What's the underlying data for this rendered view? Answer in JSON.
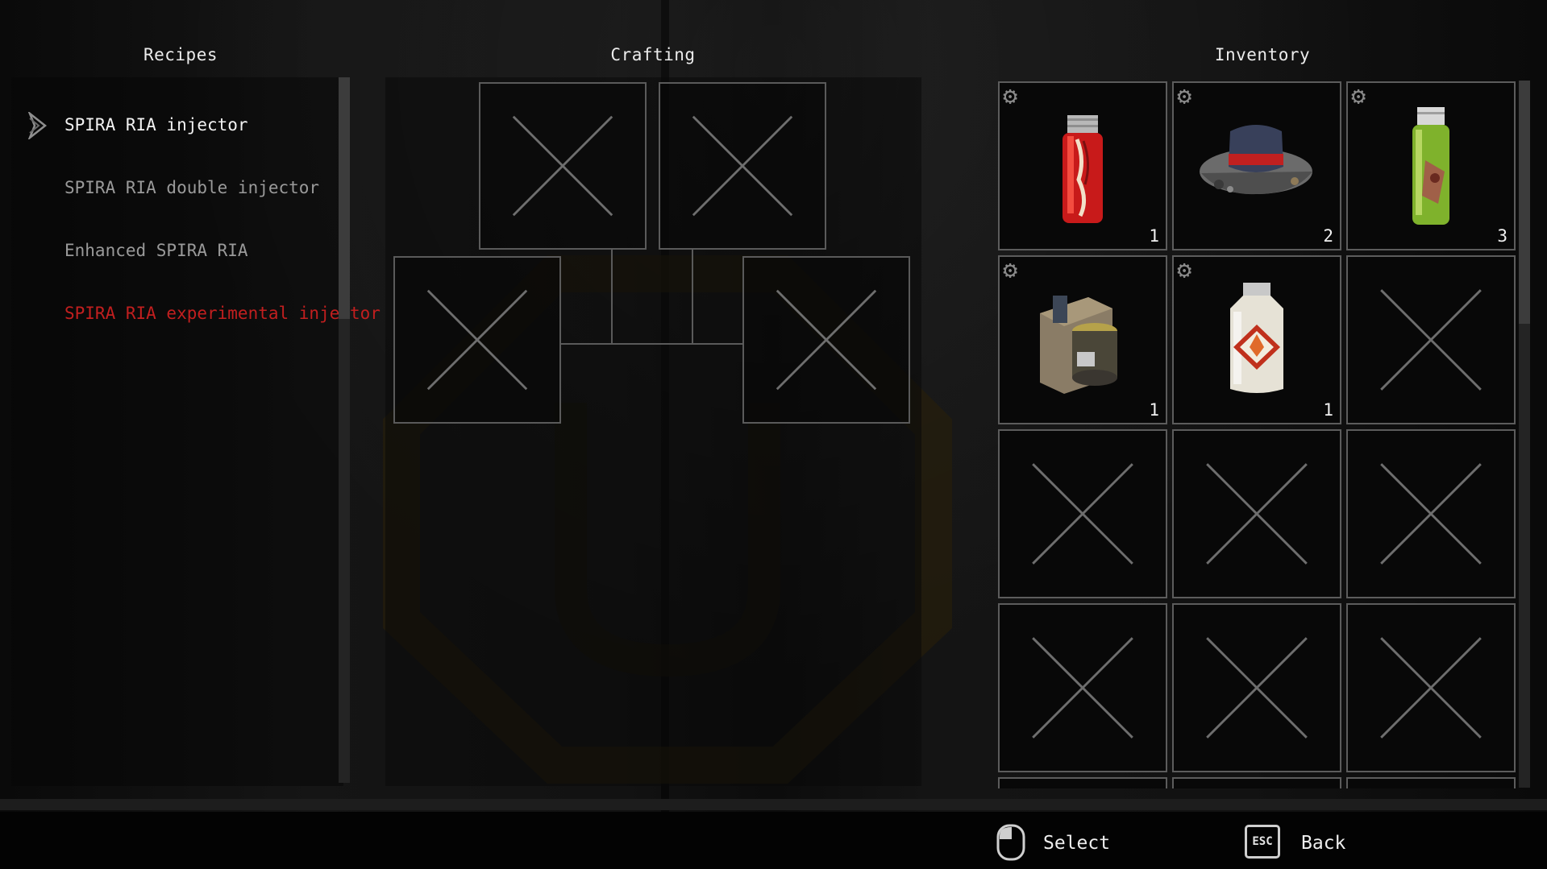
{
  "headings": {
    "recipes": "Recipes",
    "crafting": "Crafting",
    "inventory": "Inventory"
  },
  "recipes": [
    {
      "label": "SPIRA RIA injector",
      "state": "selected"
    },
    {
      "label": "SPIRA RIA double injector",
      "state": "available"
    },
    {
      "label": "Enhanced SPIRA RIA",
      "state": "available"
    },
    {
      "label": "SPIRA RIA experimental injector",
      "state": "unavailable"
    }
  ],
  "crafting_slots": [
    "empty",
    "empty",
    "empty",
    "empty"
  ],
  "inventory": [
    {
      "item": "red-vial-icon",
      "qty": "1"
    },
    {
      "item": "stone-hat-icon",
      "qty": "2"
    },
    {
      "item": "green-vial-icon",
      "qty": "3"
    },
    {
      "item": "supply-box-icon",
      "qty": "1"
    },
    {
      "item": "chemical-bottle-icon",
      "qty": "1"
    },
    {
      "item": "empty",
      "qty": ""
    },
    {
      "item": "empty",
      "qty": ""
    },
    {
      "item": "empty",
      "qty": ""
    },
    {
      "item": "empty",
      "qty": ""
    },
    {
      "item": "empty",
      "qty": ""
    },
    {
      "item": "empty",
      "qty": ""
    },
    {
      "item": "empty",
      "qty": ""
    }
  ],
  "controls": {
    "select_label": "Select",
    "back_label": "Back",
    "back_key": "ESC"
  },
  "colors": {
    "locked_recipe": "#c21f1f",
    "selected_recipe": "#f2f2f2",
    "available_recipe": "#9a9a9a"
  }
}
